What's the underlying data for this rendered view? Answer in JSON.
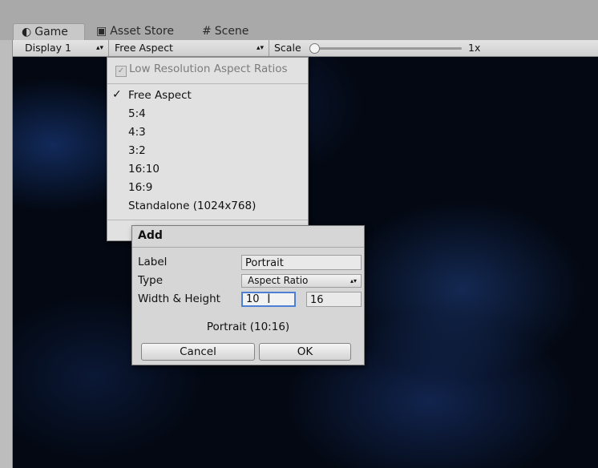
{
  "tabs": [
    {
      "label": "Game",
      "icon": "game-icon"
    },
    {
      "label": "Asset Store",
      "icon": "asset-store-icon"
    },
    {
      "label": "Scene",
      "icon": "scene-grid-icon"
    }
  ],
  "toolbar": {
    "display_value": "Display 1",
    "aspect_value": "Free Aspect",
    "scale_label": "Scale",
    "scale_value": "1x",
    "scale_fraction": 0
  },
  "aspect_menu": {
    "low_resolution_label": "Low Resolution Aspect Ratios",
    "low_resolution_checked": true,
    "items": [
      "Free Aspect",
      "5:4",
      "4:3",
      "3:2",
      "16:10",
      "16:9",
      "Standalone (1024x768)"
    ],
    "selected": "Free Aspect",
    "check_glyph": "✓"
  },
  "add_dialog": {
    "title": "Add",
    "label_caption": "Label",
    "label_value": "Portrait",
    "type_caption": "Type",
    "type_value": "Aspect Ratio",
    "size_caption": "Width & Height",
    "width_value": "10",
    "height_value": "16",
    "preview": "Portrait (10:16)",
    "cancel_label": "Cancel",
    "ok_label": "OK"
  },
  "colors": {
    "focus_border": "#4d7fd4",
    "game_background": "#030812"
  }
}
